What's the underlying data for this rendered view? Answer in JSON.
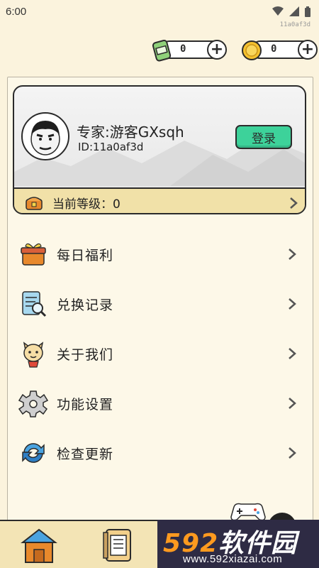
{
  "status_bar": {
    "time": "6:00"
  },
  "device_id": "11a0af3d",
  "currencies": [
    {
      "name": "cash",
      "icon": "cash-can-icon",
      "value": "0"
    },
    {
      "name": "coin",
      "icon": "gold-coin-icon",
      "value": "0"
    }
  ],
  "profile": {
    "nickname": "专家:游客GXsqh",
    "user_id": "ID:11a0af3d",
    "login_label": "登录",
    "level_label": "当前等级：0"
  },
  "menu": [
    {
      "label": "每日福利",
      "icon": "gift-icon"
    },
    {
      "label": "兑换记录",
      "icon": "record-search-icon"
    },
    {
      "label": "关于我们",
      "icon": "mascot-icon"
    },
    {
      "label": "功能设置",
      "icon": "gear-icon"
    },
    {
      "label": "检查更新",
      "icon": "refresh-icon"
    }
  ],
  "bottom_nav": [
    {
      "name": "home",
      "icon": "house-icon"
    },
    {
      "name": "tasks",
      "icon": "notebook-icon"
    }
  ],
  "watermark": {
    "brand_num": "592",
    "brand_text": "软件园",
    "url": "www.592xiazai.com"
  },
  "colors": {
    "background": "#fbf3dd",
    "login_green": "#3dd29a",
    "level_bar": "#f1e1a8",
    "nav": "#f3e4b5"
  }
}
